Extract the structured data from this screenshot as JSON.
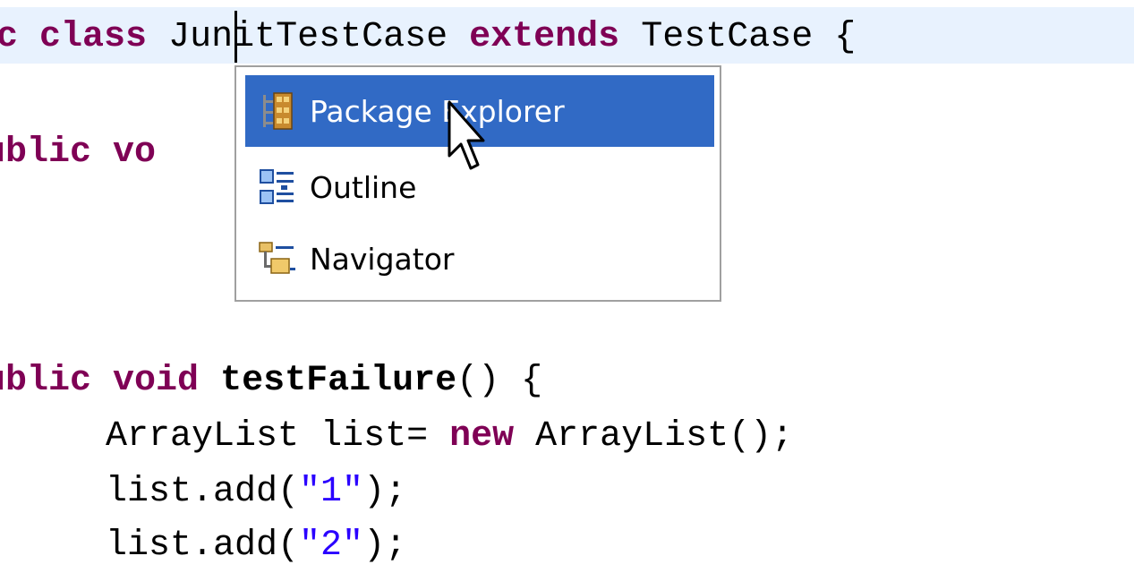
{
  "editor": {
    "line1": {
      "kw_public_fragment": "c",
      "kw_class": "class",
      "class_name": "JunitTestCase",
      "kw_extends": "extends",
      "superclass": "TestCase",
      "brace": "{"
    },
    "line2": {
      "kw_public_fragment": "ublic",
      "kw_void_fragment": "vo"
    },
    "line3": {
      "kw_public_fragment": "ublic",
      "kw_void": "void",
      "method_name": "testFailure",
      "rest": "() {"
    },
    "line4": {
      "type": "ArrayList",
      "decl": "list=",
      "kw_new": "new",
      "ctor": "ArrayList();"
    },
    "line5": {
      "call": "list.add(",
      "str": "\"1\"",
      "end": ");"
    },
    "line6": {
      "call": "list.add(",
      "str": "\"2\"",
      "end": ");"
    }
  },
  "popup": {
    "items": [
      {
        "label": "Package Explorer",
        "icon": "package-explorer-icon",
        "selected": true
      },
      {
        "label": "Outline",
        "icon": "outline-icon",
        "selected": false
      },
      {
        "label": "Navigator",
        "icon": "navigator-icon",
        "selected": false
      }
    ]
  },
  "colors": {
    "keyword": "#7f0055",
    "string": "#2a00ff",
    "selection": "#316ac5",
    "current_line": "#e8f2fe"
  }
}
